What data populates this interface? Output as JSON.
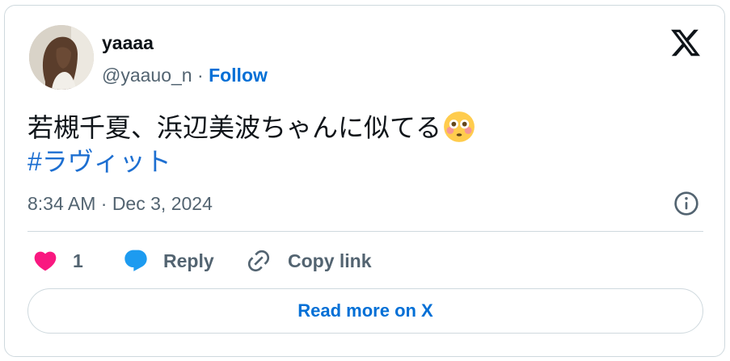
{
  "author": {
    "name": "yaaaa",
    "handle": "@yaauo_n",
    "separator": " · ",
    "follow_label": "Follow"
  },
  "tweet": {
    "text": "若槻千夏、浜辺美波ちゃんに似てる",
    "emoji": "flushed-face",
    "hashtag": "#ラヴィット",
    "timestamp": "8:34 AM · Dec 3, 2024"
  },
  "actions": {
    "like_count": "1",
    "reply_label": "Reply",
    "copy_link_label": "Copy link"
  },
  "read_more_label": "Read more on X",
  "colors": {
    "link_blue": "#006fd6",
    "hashtag_blue": "#1d6fd1",
    "like_pink": "#f91880",
    "reply_blue": "#1d9bf0",
    "muted_gray": "#536471",
    "border": "#cfd9de"
  }
}
